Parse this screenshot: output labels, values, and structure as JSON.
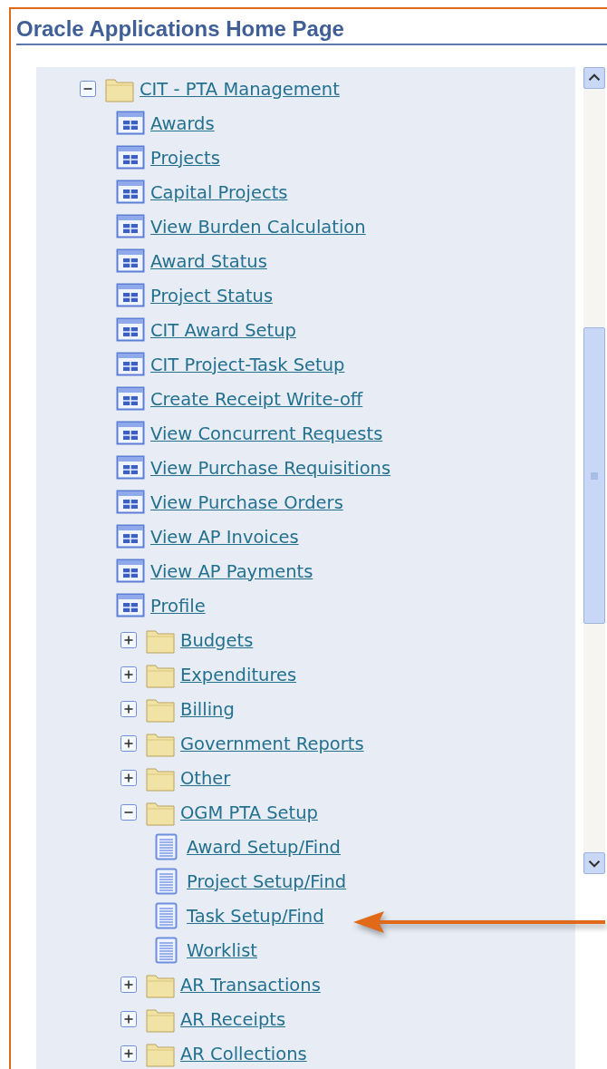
{
  "page": {
    "title": "Oracle Applications Home Page"
  },
  "tree": [
    {
      "kind": "folder",
      "label": "CIT - PTA Management",
      "expanded": true,
      "children": [
        {
          "kind": "function",
          "label": "Awards"
        },
        {
          "kind": "function",
          "label": "Projects"
        },
        {
          "kind": "function",
          "label": "Capital Projects"
        },
        {
          "kind": "function",
          "label": "View Burden Calculation"
        },
        {
          "kind": "function",
          "label": "Award Status"
        },
        {
          "kind": "function",
          "label": "Project Status"
        },
        {
          "kind": "function",
          "label": "CIT Award Setup"
        },
        {
          "kind": "function",
          "label": "CIT Project-Task Setup"
        },
        {
          "kind": "function",
          "label": "Create Receipt Write-off"
        },
        {
          "kind": "function",
          "label": "View Concurrent Requests"
        },
        {
          "kind": "function",
          "label": "View Purchase Requisitions"
        },
        {
          "kind": "function",
          "label": "View Purchase Orders"
        },
        {
          "kind": "function",
          "label": "View AP Invoices"
        },
        {
          "kind": "function",
          "label": "View AP Payments"
        },
        {
          "kind": "function",
          "label": "Profile"
        },
        {
          "kind": "folder",
          "label": "Budgets",
          "expanded": false
        },
        {
          "kind": "folder",
          "label": "Expenditures",
          "expanded": false
        },
        {
          "kind": "folder",
          "label": "Billing",
          "expanded": false
        },
        {
          "kind": "folder",
          "label": "Government Reports",
          "expanded": false
        },
        {
          "kind": "folder",
          "label": "Other",
          "expanded": false
        },
        {
          "kind": "folder",
          "label": "OGM PTA Setup",
          "expanded": true,
          "children": [
            {
              "kind": "document",
              "label": "Award Setup/Find"
            },
            {
              "kind": "document",
              "label": "Project Setup/Find"
            },
            {
              "kind": "document",
              "label": "Task Setup/Find"
            },
            {
              "kind": "document",
              "label": "Worklist"
            }
          ]
        },
        {
          "kind": "folder",
          "label": "AR Transactions",
          "expanded": false
        },
        {
          "kind": "folder",
          "label": "AR Receipts",
          "expanded": false
        },
        {
          "kind": "folder",
          "label": "AR Collections",
          "expanded": false
        }
      ]
    }
  ]
}
